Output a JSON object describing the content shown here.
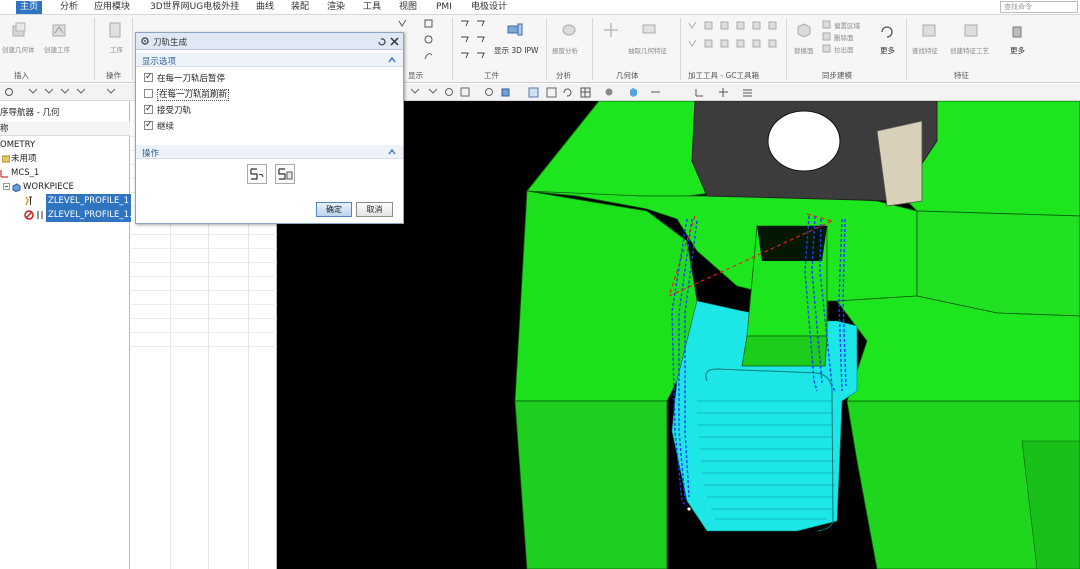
{
  "menubar": {
    "tabs": [
      "主页",
      "分析",
      "应用模块",
      "3D世界网UG电极外挂",
      "曲线",
      "装配",
      "渲染",
      "工具",
      "视图",
      "PMI",
      "电极设计"
    ],
    "active_tab": "主页",
    "search_placeholder": "查找命令"
  },
  "ribbon": {
    "insert_group": {
      "label": "插入",
      "btn1": "创建几何体",
      "btn2": "创建工序"
    },
    "operation_group": {
      "label": "操作",
      "btn1": "工序"
    },
    "display_group": {
      "label": "显示"
    },
    "workpiece_group": {
      "label": "工件",
      "btn1": "显示 3D IPW"
    },
    "analysis_group": {
      "label": "分析",
      "btn1": "报废分析"
    },
    "geometry_group": {
      "label": "几何体",
      "btn1": "抽取几何特征"
    },
    "gc_group": {
      "label": "加工工具 - GC工具箱"
    },
    "sync_group": {
      "label": "同步建模",
      "btn1": "替换面",
      "btn2": "偏置区域",
      "btn3": "删除面",
      "btn4": "拉出面",
      "more": "更多"
    },
    "feature_group": {
      "label": "特征",
      "btn1": "查找特征",
      "btn2": "创建特征工艺",
      "more": "更多"
    }
  },
  "navigator": {
    "title": "序导航器 - 几何",
    "column_header": "称",
    "rows": [
      {
        "label": "OMETRY"
      },
      {
        "label": "未用项"
      },
      {
        "label": "MCS_1"
      },
      {
        "label": "WORKPIECE"
      },
      {
        "label": "ZLEVEL_PROFILE_1"
      },
      {
        "label": "ZLEVEL_PROFILE_1..."
      }
    ]
  },
  "dialog": {
    "title": "刀轨生成",
    "section1": "显示选项",
    "options": [
      {
        "label": "在每一刀轨后暂停",
        "checked": true
      },
      {
        "label": "在每一刀轨前刷新",
        "checked": false
      },
      {
        "label": "接受刀轨",
        "checked": true
      },
      {
        "label": "继续",
        "checked": true
      }
    ],
    "section2": "操作",
    "ok_label": "确定",
    "cancel_label": "取消"
  },
  "viewport": {
    "background": "#000000",
    "model_color": "#1ee61e",
    "pocket_color": "#1de6e6",
    "fixture_color": "#3c3c3c",
    "toolpath_color": "#1a3cff",
    "engage_color": "#e02020"
  }
}
